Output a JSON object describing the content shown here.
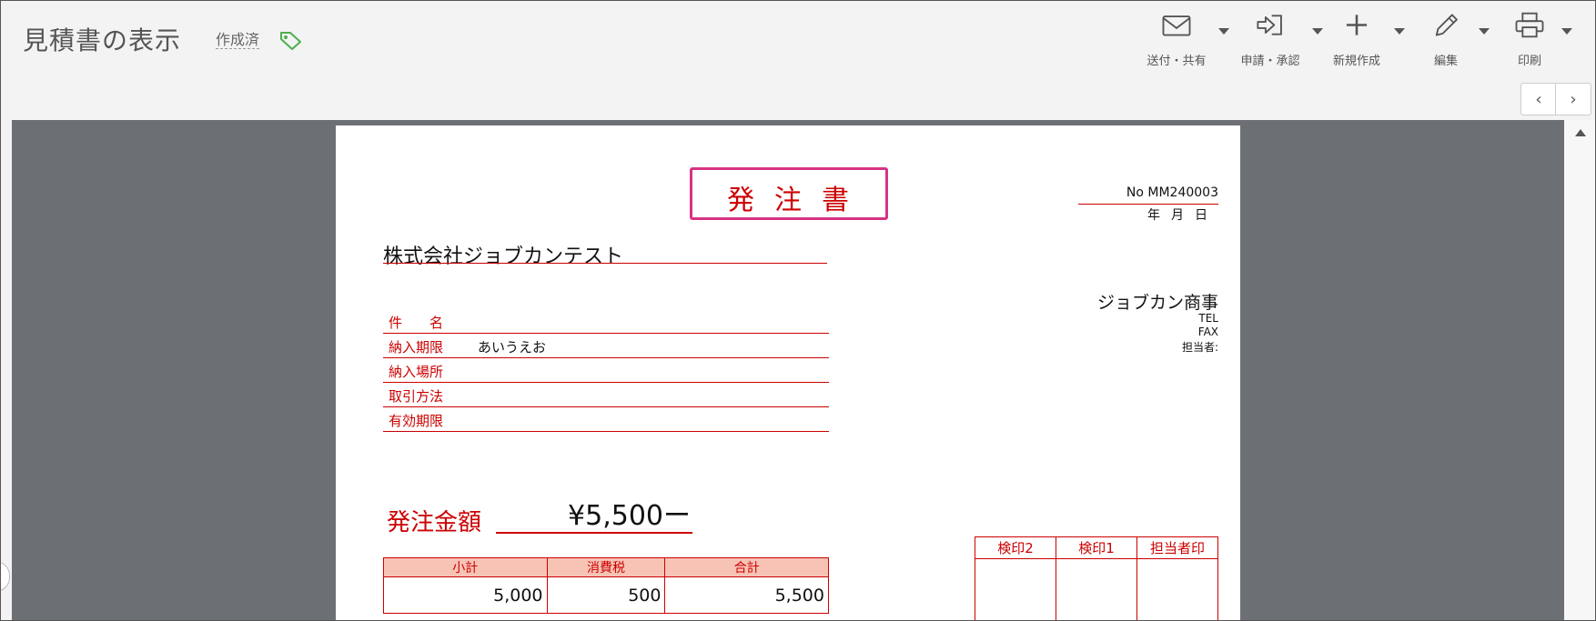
{
  "header": {
    "title": "見積書の表示",
    "status": "作成済"
  },
  "toolbar": {
    "send": "送付・共有",
    "apply": "申請・承認",
    "new": "新規作成",
    "edit": "編集",
    "print": "印刷"
  },
  "pager": {
    "prev": "‹",
    "next": "›"
  },
  "document": {
    "title": "発注書",
    "number": "No MM240003",
    "date_label": "年月日",
    "client": "株式会社ジョブカンテスト",
    "issuer": {
      "company": "ジョブカン商事",
      "tel": "TEL",
      "fax": "FAX",
      "person": "担当者:"
    },
    "fields": [
      {
        "label": "件　　名",
        "value": ""
      },
      {
        "label": "納入期限",
        "value": "あいうえお"
      },
      {
        "label": "納入場所",
        "value": ""
      },
      {
        "label": "取引方法",
        "value": ""
      },
      {
        "label": "有効期限",
        "value": ""
      }
    ],
    "amount_label": "発注金額",
    "amount_value": "¥5,500ー",
    "summary": {
      "headers": [
        "小計",
        "消費税",
        "合計"
      ],
      "values": [
        "5,000",
        "500",
        "5,500"
      ]
    },
    "stamps": [
      "検印2",
      "検印1",
      "担当者印"
    ]
  }
}
